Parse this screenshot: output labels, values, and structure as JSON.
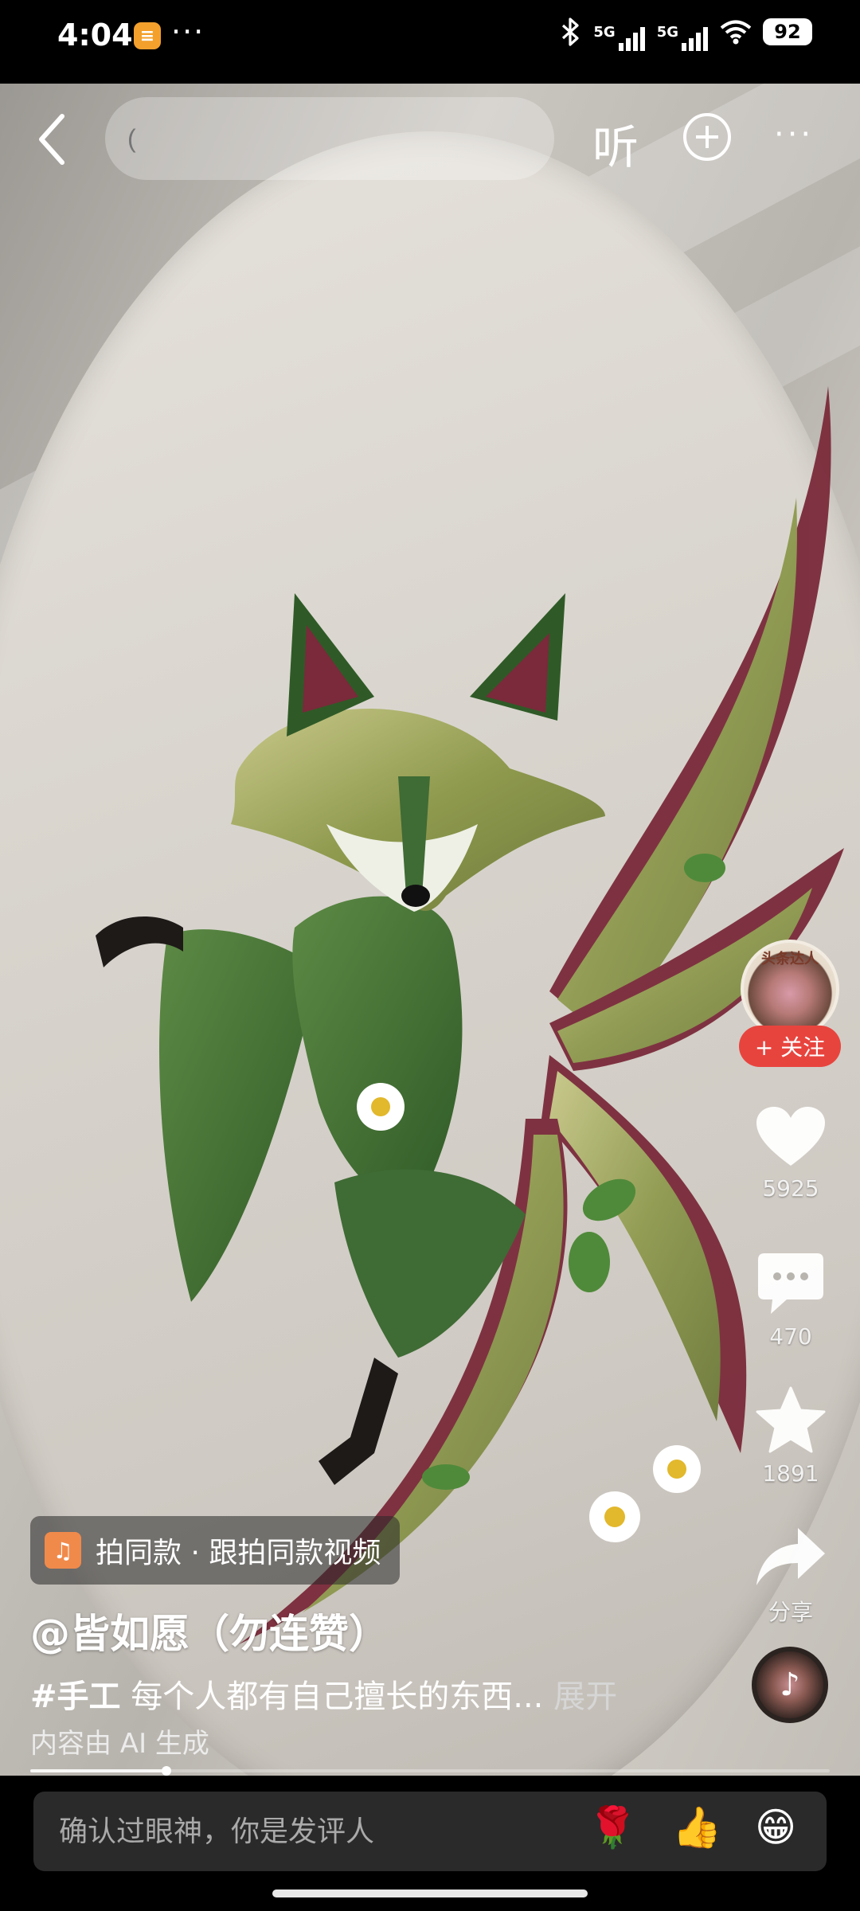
{
  "status_bar": {
    "time": "4:04",
    "dots": "···",
    "bluetooth_icon": "bluetooth-icon",
    "signal_1": "5G",
    "signal_2": "5G",
    "wifi_icon": "wifi-icon",
    "battery": "92"
  },
  "top_bar": {
    "search_placeholder": "(",
    "listen_label": "听",
    "add_icon": "plus-circle-icon",
    "more_icon": "more-dots-icon"
  },
  "author": {
    "avatar_tag": "头条达人",
    "follow_label": "+ 关注",
    "name": "@皆如愿（勿连赞）"
  },
  "actions": {
    "like_count": "5925",
    "comment_count": "470",
    "favorite_count": "1891",
    "share_label": "分享"
  },
  "video_info": {
    "same_style_label": "拍同款 · 跟拍同款视频",
    "hashtag": "#手工",
    "caption": " 每个人都有自己擅长的东西...",
    "expand_label": " 展开",
    "ai_notice": "内容由 AI 生成",
    "progress_fraction": 0.17
  },
  "comment_bar": {
    "placeholder": "确认过眼神，你是发评人",
    "emojis": [
      "🌹",
      "👍",
      "😁"
    ]
  },
  "colors": {
    "follow_red": "#e8443e",
    "leaf_green": "#3f6b35",
    "grass_red": "#7a2a3a"
  }
}
